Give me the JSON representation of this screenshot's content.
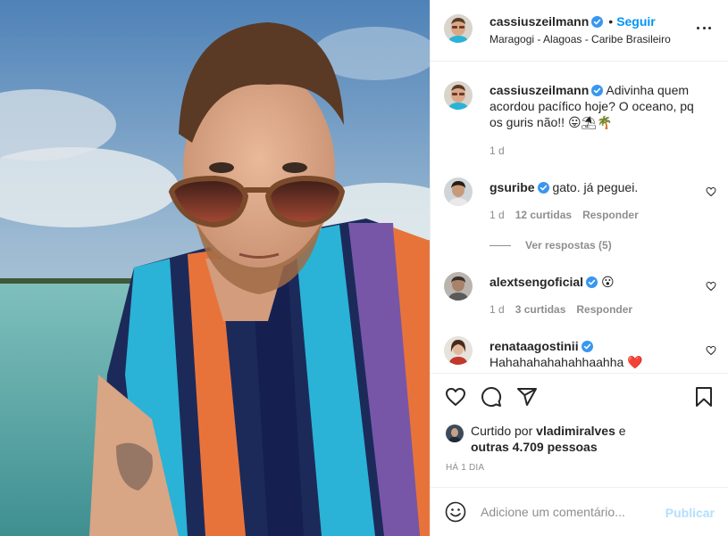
{
  "post": {
    "author": {
      "username": "cassiuszeilmann",
      "verified": true,
      "follow_label": "Seguir",
      "location": "Maragogi - Alagoas - Caribe Brasileiro"
    },
    "caption": {
      "username": "cassiuszeilmann",
      "text": "Adivinha quem acordou pacífico hoje? O oceano, pq os guris não!! 😛⛱🌴",
      "time": "1 d"
    },
    "comments": [
      {
        "username": "gsuribe",
        "verified": true,
        "text": "gato. já peguei.",
        "time": "1 d",
        "likes": "12 curtidas",
        "reply_label": "Responder",
        "view_replies": "Ver respostas (5)"
      },
      {
        "username": "alextsengoficial",
        "verified": true,
        "text": "😮",
        "time": "1 d",
        "likes": "3 curtidas",
        "reply_label": "Responder"
      },
      {
        "username": "renataagostinii",
        "verified": true,
        "text": "Hahahahahahahhaahha ❤️"
      }
    ],
    "liked_by": {
      "prefix": "Curtido por",
      "username": "vladimiralves",
      "conj": "e",
      "others": "outras 4.709 pessoas"
    },
    "timestamp": "HÁ 1 DIA",
    "add_comment": {
      "placeholder": "Adicione um comentário...",
      "publish_label": "Publicar"
    },
    "icons": {
      "like": "heart-icon",
      "comment": "comment-icon",
      "share": "send-icon",
      "save": "bookmark-icon",
      "more": "more-options-icon",
      "emoji": "emoji-icon",
      "verified": "verified-badge-icon"
    },
    "colors": {
      "link": "#0095f6",
      "publish_disabled": "#b2dffc",
      "verified": "#3897f0",
      "muted": "#8e8e8e"
    }
  }
}
